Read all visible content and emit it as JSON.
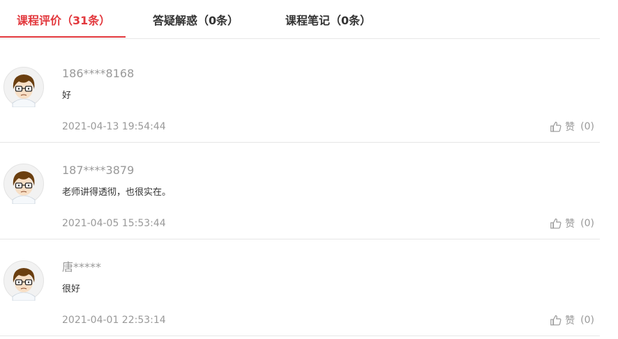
{
  "tabs": [
    {
      "label": "课程评价（31条）",
      "active": true
    },
    {
      "label": "答疑解惑（0条）",
      "active": false
    },
    {
      "label": "课程笔记（0条）",
      "active": false
    }
  ],
  "colors": {
    "accent": "#e2383d",
    "muted": "#999999",
    "text": "#333333",
    "divider": "#e6e6e6"
  },
  "comments": [
    {
      "user": "186****8168",
      "content": "好",
      "time": "2021-04-13 19:54:44",
      "like_label": "赞",
      "like_count": "(0)",
      "avatar_icon": "cartoon-boy-glasses-avatar"
    },
    {
      "user": "187****3879",
      "content": "老师讲得透彻，也很实在。",
      "time": "2021-04-05 15:53:44",
      "like_label": "赞",
      "like_count": "(0)",
      "avatar_icon": "cartoon-boy-glasses-avatar"
    },
    {
      "user": "唐*****",
      "content": "很好",
      "time": "2021-04-01 22:53:14",
      "like_label": "赞",
      "like_count": "(0)",
      "avatar_icon": "cartoon-boy-glasses-avatar"
    }
  ]
}
